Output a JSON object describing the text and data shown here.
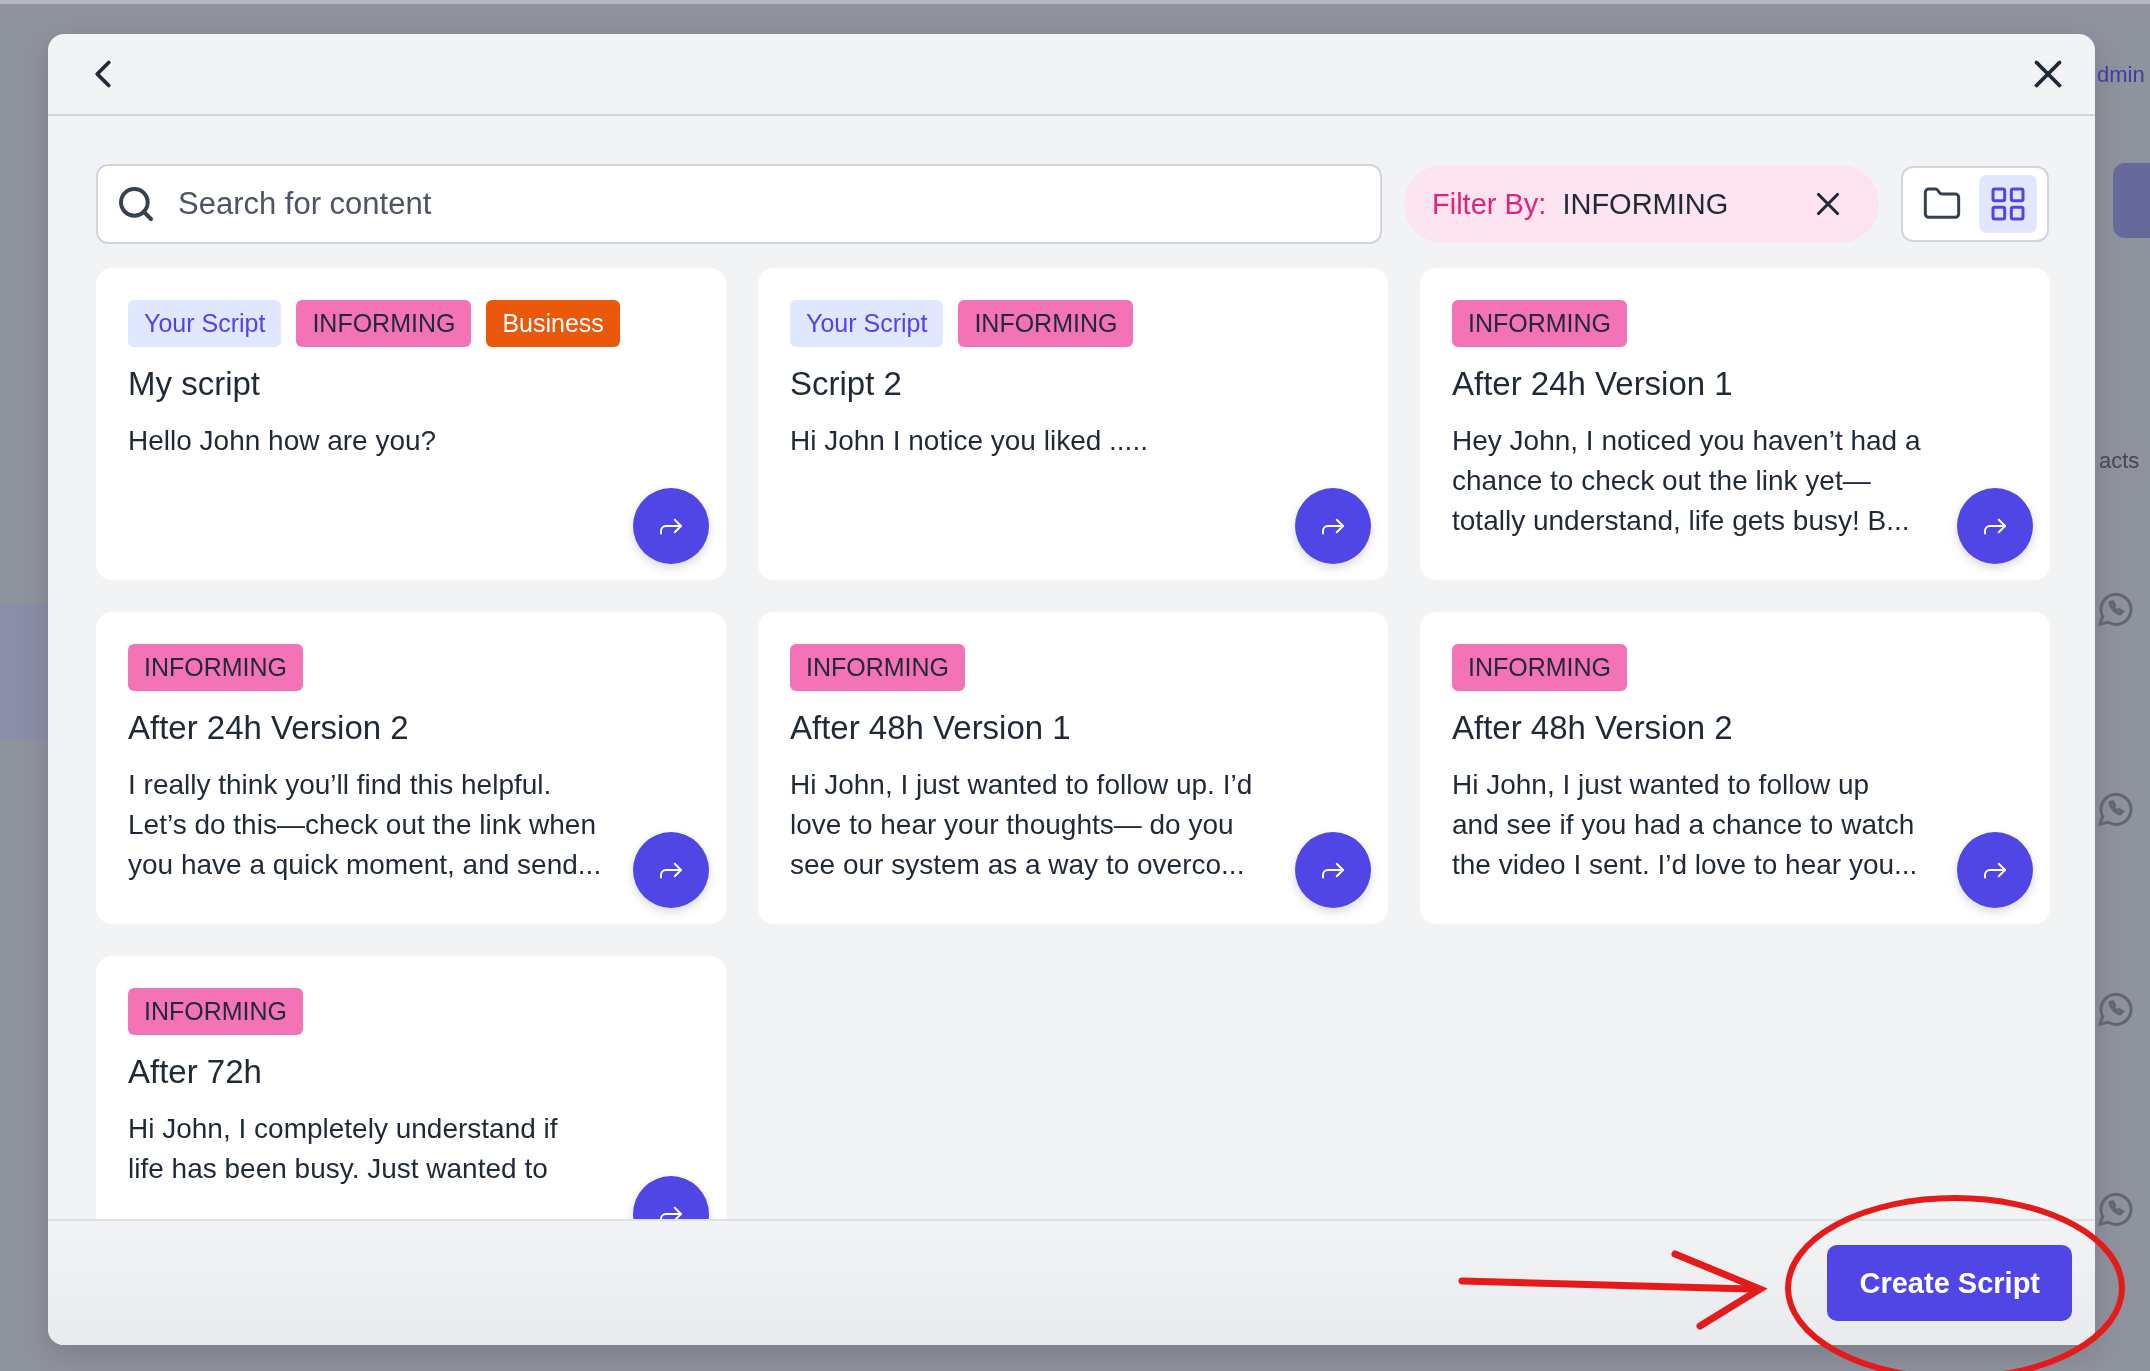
{
  "background": {
    "texts": [
      {
        "kind": "link",
        "text": "dmin"
      },
      {
        "kind": "heading",
        "text": "acts"
      }
    ]
  },
  "search": {
    "placeholder": "Search for content"
  },
  "filter": {
    "label": "Filter By:",
    "value": "INFORMING"
  },
  "view_toggle": [
    {
      "kind": "folder",
      "selected": false
    },
    {
      "kind": "grid",
      "selected": true
    }
  ],
  "cards": [
    {
      "tags": [
        {
          "kind": "source",
          "text": "Your Script"
        },
        {
          "kind": "category",
          "text": "INFORMING"
        },
        {
          "kind": "business",
          "text": "Business"
        }
      ],
      "title": "My script",
      "body": [
        "Hello John how are you?"
      ]
    },
    {
      "tags": [
        {
          "kind": "source",
          "text": "Your Script"
        },
        {
          "kind": "category",
          "text": "INFORMING"
        }
      ],
      "title": "Script 2",
      "body": [
        "Hi John I notice you liked ....."
      ]
    },
    {
      "tags": [
        {
          "kind": "category",
          "text": "INFORMING"
        }
      ],
      "title": "After 24h Version 1",
      "body": [
        "Hey John, I noticed you haven’t had a",
        "chance to check out the link yet—",
        "totally understand, life gets busy! B..."
      ]
    },
    {
      "tags": [
        {
          "kind": "category",
          "text": "INFORMING"
        }
      ],
      "title": "After 24h Version 2",
      "body": [
        "I really think you’ll find this helpful.",
        "Let’s do this—check out the link when",
        "you have a quick moment, and send..."
      ]
    },
    {
      "tags": [
        {
          "kind": "category",
          "text": "INFORMING"
        }
      ],
      "title": "After 48h Version 1",
      "body": [
        "Hi John, I just wanted to follow up. I’d",
        "love to hear your thoughts— do you",
        "see our system as a way to overco..."
      ]
    },
    {
      "tags": [
        {
          "kind": "category",
          "text": "INFORMING"
        }
      ],
      "title": "After 48h Version 2",
      "body": [
        "Hi John, I just wanted to follow up",
        "and see if you had a chance to watch",
        "the video I sent. I’d love to hear you..."
      ]
    },
    {
      "tags": [
        {
          "kind": "category",
          "text": "INFORMING"
        }
      ],
      "title": "After 72h",
      "body": [
        "Hi John, I completely understand if",
        "life has been busy. Just wanted to"
      ]
    }
  ],
  "footer": {
    "button": "Create Script"
  },
  "annotation": {
    "kind": "arrow-and-circle"
  }
}
